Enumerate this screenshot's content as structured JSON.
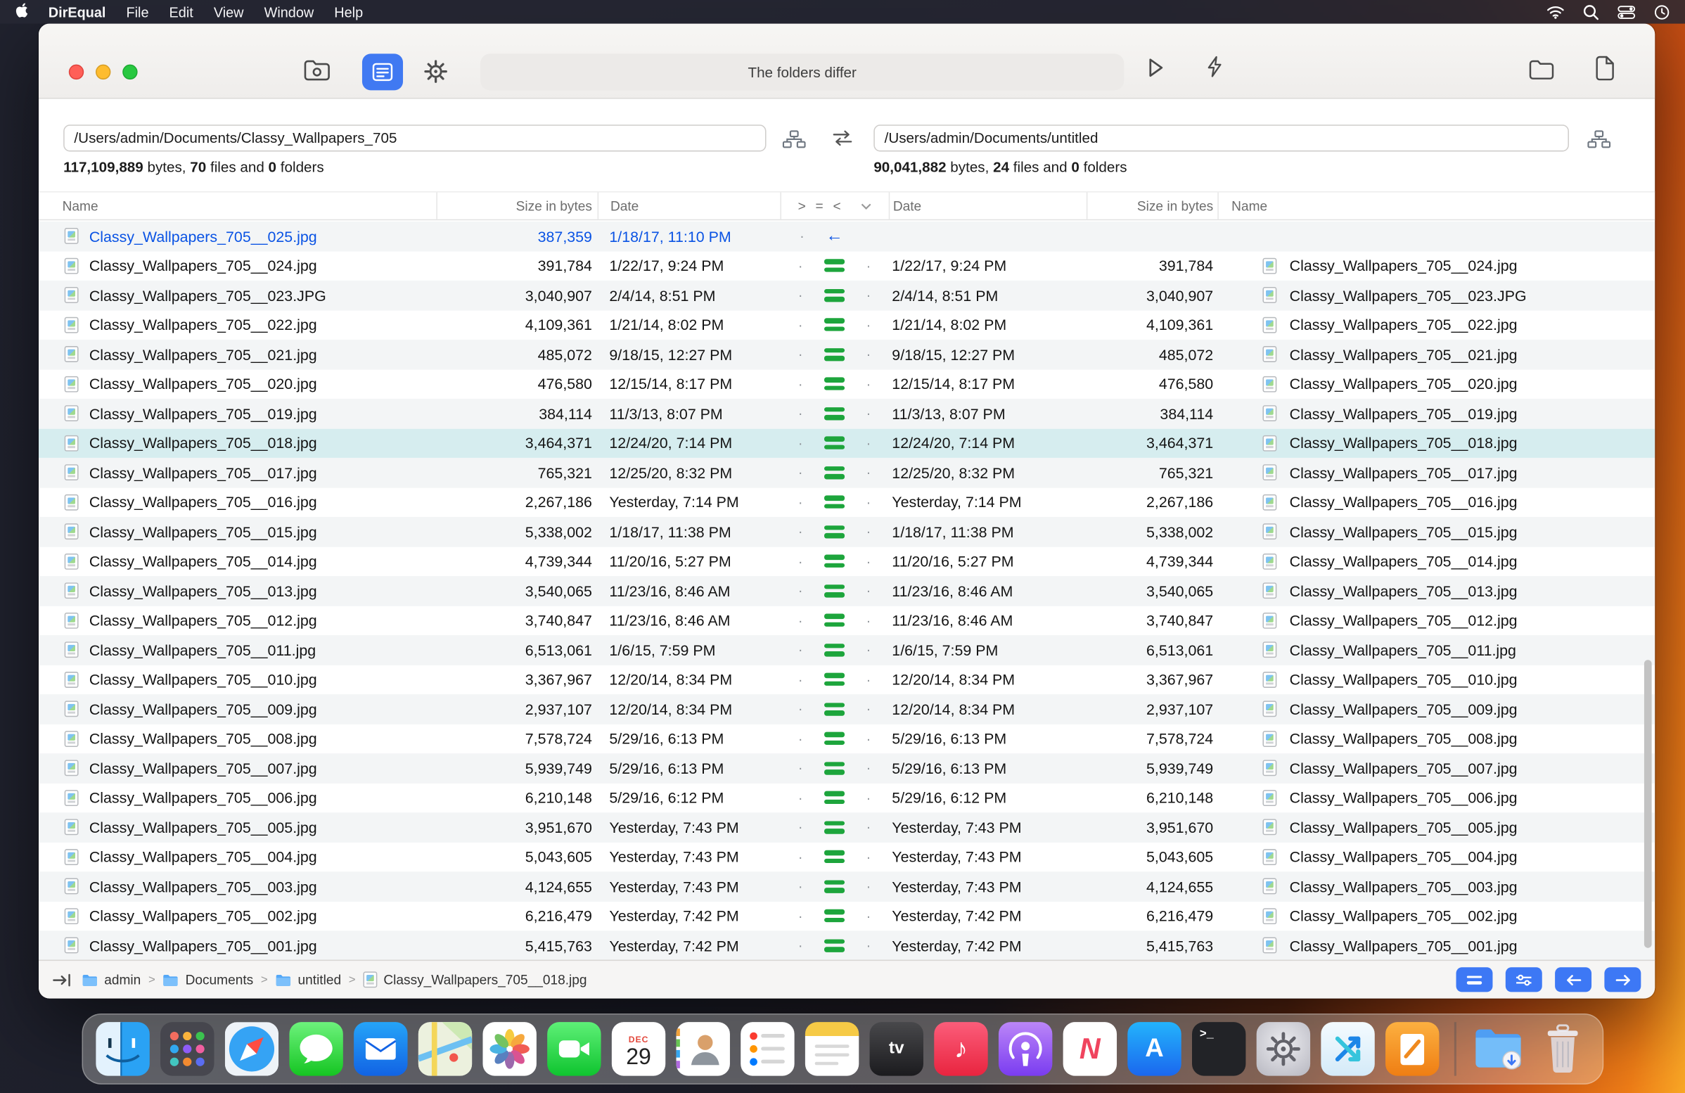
{
  "menu_bar": {
    "app_name": "DirEqual",
    "menus": [
      "File",
      "Edit",
      "View",
      "Window",
      "Help"
    ]
  },
  "toolbar": {
    "status_text": "The folders differ"
  },
  "panes": {
    "left": {
      "path": "/Users/admin/Documents/Classy_Wallpapers_705",
      "bytes": "117,109,889",
      "bytes_label": " bytes, ",
      "files": "70",
      "files_label": " files and ",
      "folders": "0",
      "folders_label": " folders"
    },
    "right": {
      "path": "/Users/admin/Documents/untitled",
      "bytes": "90,041,882",
      "bytes_label": " bytes, ",
      "files": "24",
      "files_label": " files and ",
      "folders": "0",
      "folders_label": " folders"
    }
  },
  "table": {
    "headers": {
      "name": "Name",
      "size": "Size in bytes",
      "date": "Date",
      "gt": ">",
      "eq": "=",
      "lt": "<"
    },
    "rows": [
      {
        "name": "Classy_Wallpapers_705__025.jpg",
        "size": "387,359",
        "date": "1/18/17, 11:10 PM",
        "status": "left_only",
        "selected": false
      },
      {
        "name": "Classy_Wallpapers_705__024.jpg",
        "size": "391,784",
        "date": "1/22/17, 9:24 PM",
        "status": "equal",
        "selected": false
      },
      {
        "name": "Classy_Wallpapers_705__023.JPG",
        "size": "3,040,907",
        "date": "2/4/14, 8:51 PM",
        "status": "equal",
        "selected": false
      },
      {
        "name": "Classy_Wallpapers_705__022.jpg",
        "size": "4,109,361",
        "date": "1/21/14, 8:02 PM",
        "status": "equal",
        "selected": false
      },
      {
        "name": "Classy_Wallpapers_705__021.jpg",
        "size": "485,072",
        "date": "9/18/15, 12:27 PM",
        "status": "equal",
        "selected": false
      },
      {
        "name": "Classy_Wallpapers_705__020.jpg",
        "size": "476,580",
        "date": "12/15/14, 8:17 PM",
        "status": "equal",
        "selected": false
      },
      {
        "name": "Classy_Wallpapers_705__019.jpg",
        "size": "384,114",
        "date": "11/3/13, 8:07 PM",
        "status": "equal",
        "selected": false
      },
      {
        "name": "Classy_Wallpapers_705__018.jpg",
        "size": "3,464,371",
        "date": "12/24/20, 7:14 PM",
        "status": "equal",
        "selected": true
      },
      {
        "name": "Classy_Wallpapers_705__017.jpg",
        "size": "765,321",
        "date": "12/25/20, 8:32 PM",
        "status": "equal",
        "selected": false
      },
      {
        "name": "Classy_Wallpapers_705__016.jpg",
        "size": "2,267,186",
        "date": "Yesterday, 7:14 PM",
        "status": "equal",
        "selected": false
      },
      {
        "name": "Classy_Wallpapers_705__015.jpg",
        "size": "5,338,002",
        "date": "1/18/17, 11:38 PM",
        "status": "equal",
        "selected": false
      },
      {
        "name": "Classy_Wallpapers_705__014.jpg",
        "size": "4,739,344",
        "date": "11/20/16, 5:27 PM",
        "status": "equal",
        "selected": false
      },
      {
        "name": "Classy_Wallpapers_705__013.jpg",
        "size": "3,540,065",
        "date": "11/23/16, 8:46 AM",
        "status": "equal",
        "selected": false
      },
      {
        "name": "Classy_Wallpapers_705__012.jpg",
        "size": "3,740,847",
        "date": "11/23/16, 8:46 AM",
        "status": "equal",
        "selected": false
      },
      {
        "name": "Classy_Wallpapers_705__011.jpg",
        "size": "6,513,061",
        "date": "1/6/15, 7:59 PM",
        "status": "equal",
        "selected": false
      },
      {
        "name": "Classy_Wallpapers_705__010.jpg",
        "size": "3,367,967",
        "date": "12/20/14, 8:34 PM",
        "status": "equal",
        "selected": false
      },
      {
        "name": "Classy_Wallpapers_705__009.jpg",
        "size": "2,937,107",
        "date": "12/20/14, 8:34 PM",
        "status": "equal",
        "selected": false
      },
      {
        "name": "Classy_Wallpapers_705__008.jpg",
        "size": "7,578,724",
        "date": "5/29/16, 6:13 PM",
        "status": "equal",
        "selected": false
      },
      {
        "name": "Classy_Wallpapers_705__007.jpg",
        "size": "5,939,749",
        "date": "5/29/16, 6:13 PM",
        "status": "equal",
        "selected": false
      },
      {
        "name": "Classy_Wallpapers_705__006.jpg",
        "size": "6,210,148",
        "date": "5/29/16, 6:12 PM",
        "status": "equal",
        "selected": false
      },
      {
        "name": "Classy_Wallpapers_705__005.jpg",
        "size": "3,951,670",
        "date": "Yesterday, 7:43 PM",
        "status": "equal",
        "selected": false
      },
      {
        "name": "Classy_Wallpapers_705__004.jpg",
        "size": "5,043,605",
        "date": "Yesterday, 7:43 PM",
        "status": "equal",
        "selected": false
      },
      {
        "name": "Classy_Wallpapers_705__003.jpg",
        "size": "4,124,655",
        "date": "Yesterday, 7:43 PM",
        "status": "equal",
        "selected": false
      },
      {
        "name": "Classy_Wallpapers_705__002.jpg",
        "size": "6,216,479",
        "date": "Yesterday, 7:42 PM",
        "status": "equal",
        "selected": false
      },
      {
        "name": "Classy_Wallpapers_705__001.jpg",
        "size": "5,415,763",
        "date": "Yesterday, 7:42 PM",
        "status": "equal",
        "selected": false
      }
    ]
  },
  "status_bar": {
    "breadcrumbs": [
      "admin",
      "Documents",
      "untitled",
      "Classy_Wallpapers_705__018.jpg"
    ]
  },
  "dock": {
    "calendar_month": "DEC",
    "calendar_day": "29"
  }
}
